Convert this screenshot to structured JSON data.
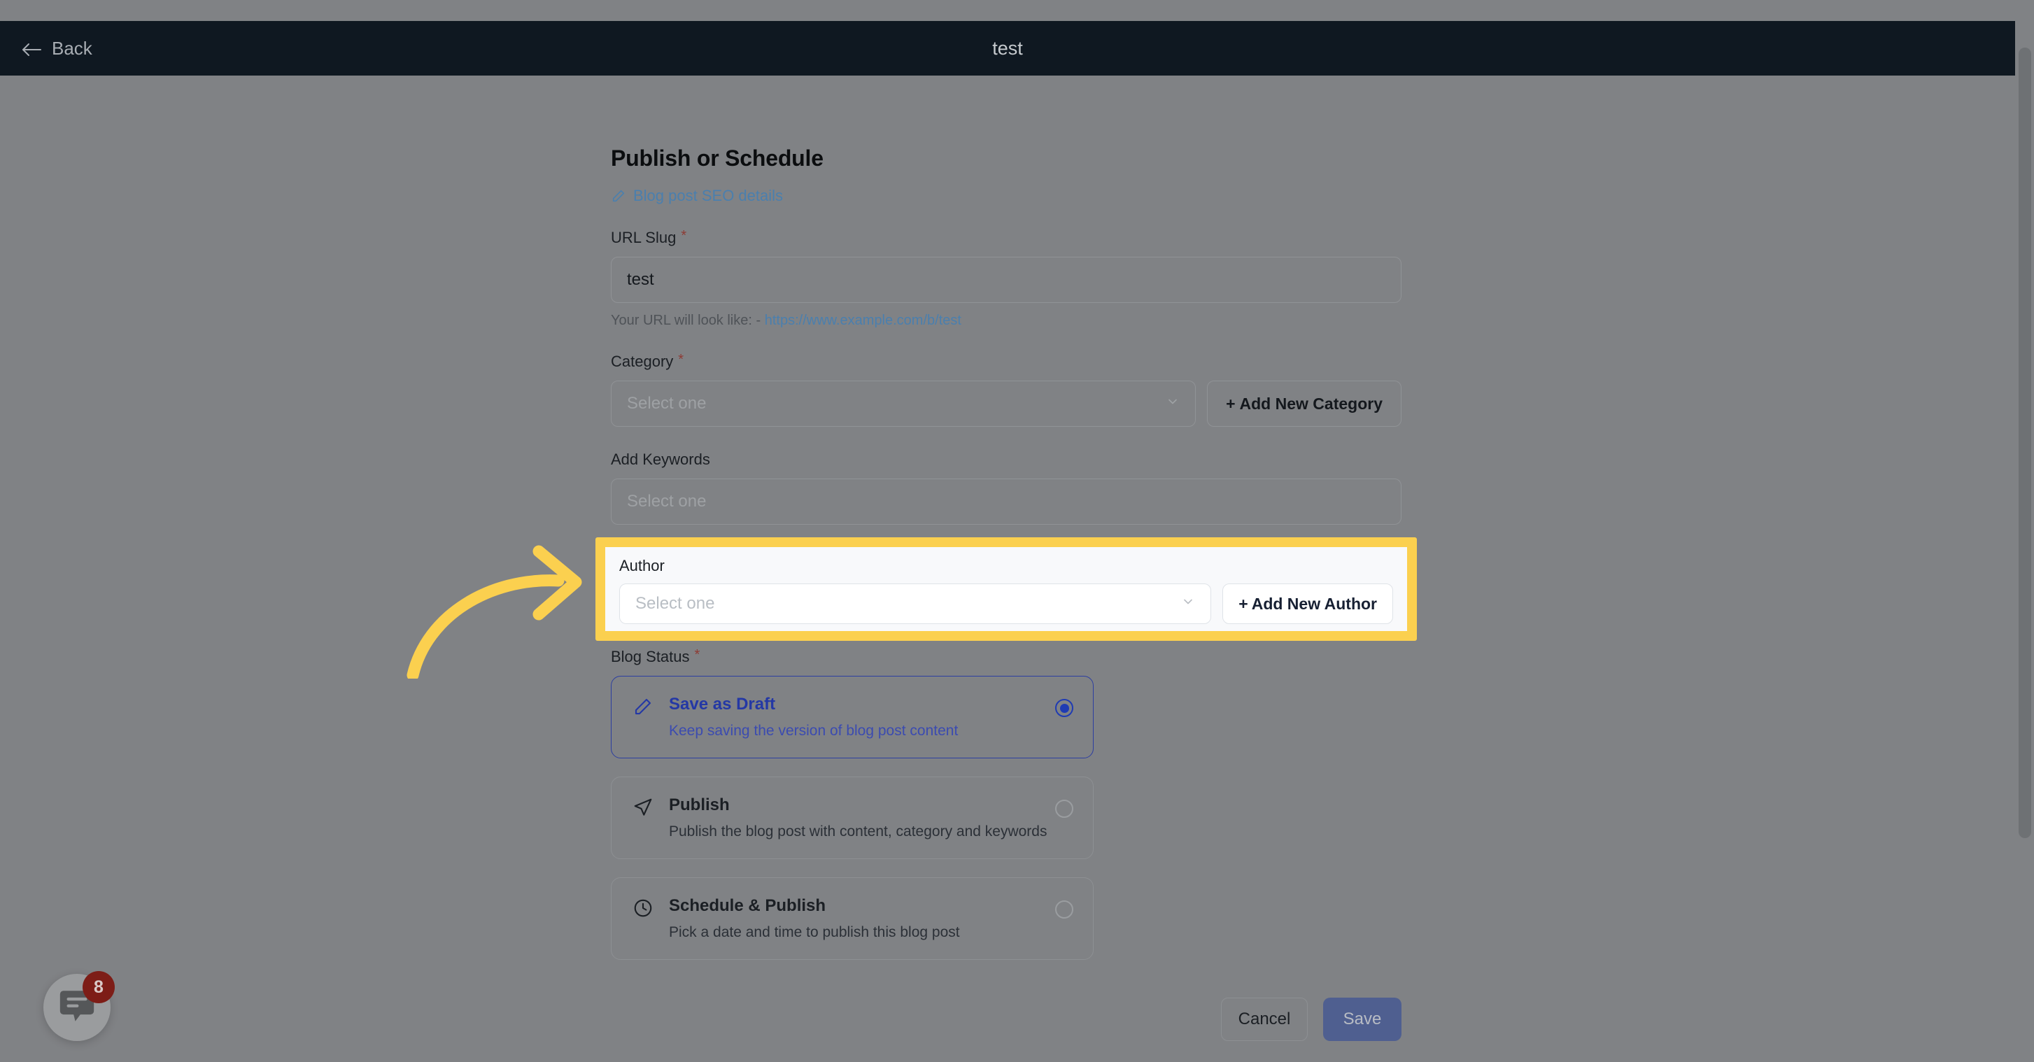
{
  "header": {
    "back_label": "Back",
    "back_icon": "arrow-left-icon",
    "title": "test"
  },
  "main": {
    "page_title": "Publish or Schedule",
    "seo_link": {
      "label": "Blog post SEO details",
      "icon": "pencil-icon"
    },
    "fields": {
      "url_slug": {
        "label": "URL Slug",
        "required_marker": "*",
        "value": "test",
        "helper_prefix": "Your URL will look like: - ",
        "helper_url": "https://www.example.com/b/test"
      },
      "category": {
        "label": "Category",
        "required_marker": "*",
        "placeholder": "Select one",
        "dropdown_icon": "chevron-down-icon",
        "add_button": "Add New Category",
        "add_icon": "plus-icon"
      },
      "keywords": {
        "label": "Add Keywords",
        "placeholder": "Select one"
      },
      "author": {
        "label": "Author",
        "placeholder": "Select one",
        "dropdown_icon": "chevron-down-icon",
        "add_button": "Add New Author",
        "add_icon": "plus-icon"
      }
    },
    "blog_status": {
      "label": "Blog Status",
      "required_marker": "*",
      "options": [
        {
          "title": "Save as Draft",
          "description": "Keep saving the version of blog post content",
          "icon": "pencil-icon",
          "selected": true
        },
        {
          "title": "Publish",
          "description": "Publish the blog post with content, category and keywords",
          "icon": "send-icon",
          "selected": false
        },
        {
          "title": "Schedule & Publish",
          "description": "Pick a date and time to publish this blog post",
          "icon": "clock-icon",
          "selected": false
        }
      ]
    },
    "footer": {
      "cancel_label": "Cancel",
      "save_label": "Save"
    }
  },
  "chat_widget": {
    "icon": "chat-bubble-icon",
    "badge_count": "8"
  },
  "annotation": {
    "type": "curved-arrow",
    "target": "author-field",
    "color": "#fbd04f"
  },
  "colors": {
    "header_bg": "#0f1821",
    "dim_overlay": "#808285",
    "highlight": "#fbd04f",
    "accent_blue": "#2438a5",
    "link_blue": "#4a7fae",
    "required_red": "#8e3b34",
    "save_button": "#4f5f90",
    "badge_red": "#7d1d17"
  }
}
